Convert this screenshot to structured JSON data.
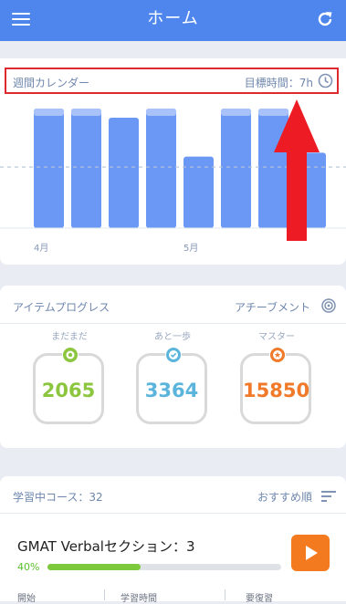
{
  "header": {
    "title": "ホーム"
  },
  "calendar": {
    "title": "週間カレンダー",
    "goal": "目標時間：7h",
    "months": [
      "4月",
      "5月"
    ]
  },
  "chart_data": {
    "type": "bar",
    "title": "週間カレンダー",
    "categories": [
      "",
      "",
      "",
      "",
      "",
      "",
      "",
      ""
    ],
    "values": [
      9.2,
      9.2,
      8.5,
      9.2,
      5.5,
      9.2,
      9.2,
      5.8
    ],
    "goal_line": 4.7,
    "ylim": [
      0,
      9.2
    ],
    "x_tick_labels": [
      "4月",
      "5月"
    ],
    "legend": "none",
    "grid": false,
    "colors": {
      "bar": "#6b98f5",
      "bar_top": "#a9c3fa",
      "goal_line": "#b7c3d3"
    }
  },
  "progress": {
    "section_title": "アイテムプログレス",
    "achievement_label": "アチーブメント",
    "items": [
      {
        "label": "まだまだ",
        "value": "2065",
        "color": "#8cc63f"
      },
      {
        "label": "あと一歩",
        "value": "3364",
        "color": "#5ab4dc"
      },
      {
        "label": "マスター",
        "value": "15850",
        "color": "#f07a2a"
      }
    ]
  },
  "courses": {
    "header": "学習中コース：32",
    "sort_label": "おすすめ順",
    "course": {
      "title": "GMAT Verbalセクション：3",
      "percent_label": "40%",
      "progress": 0.4,
      "columns": [
        "開始",
        "学習時間",
        "要復習"
      ]
    }
  }
}
